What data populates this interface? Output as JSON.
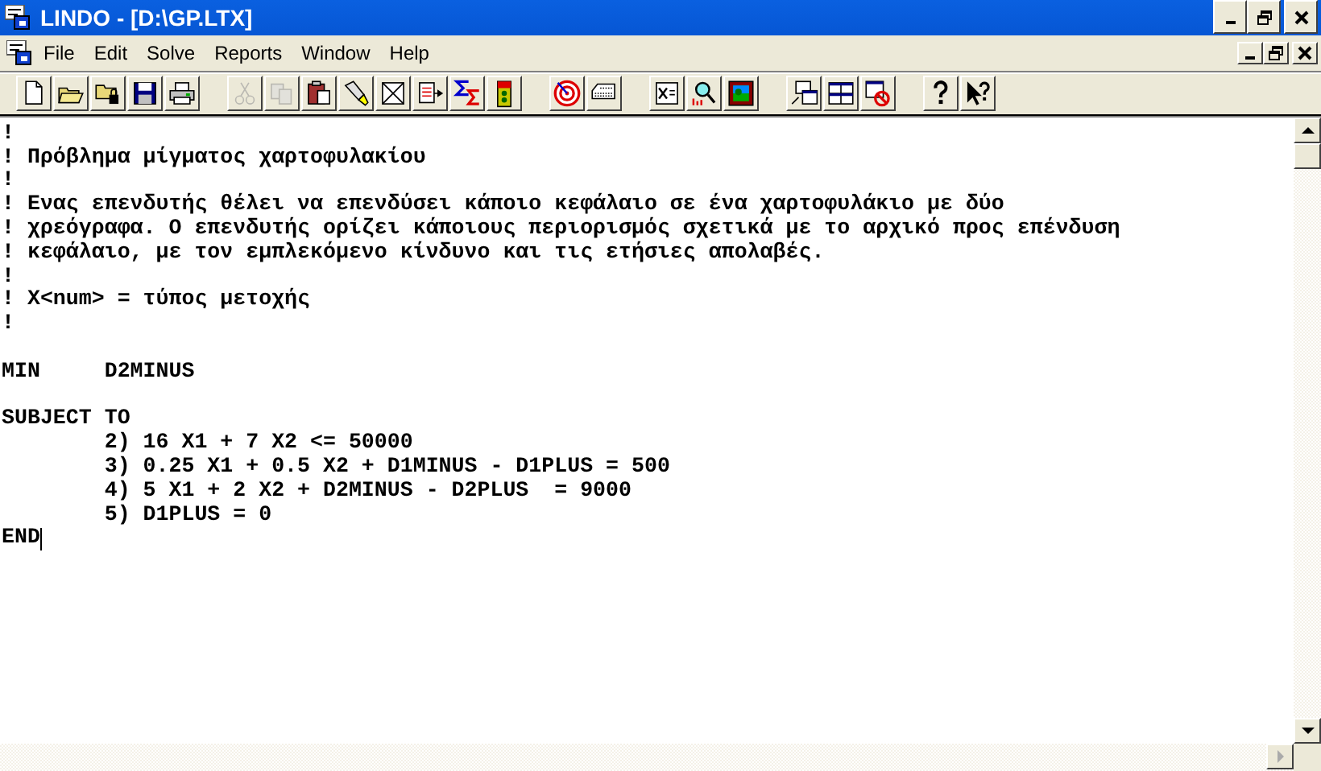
{
  "window": {
    "title": "LINDO - [D:\\GP.LTX]"
  },
  "menu": [
    {
      "label": "File"
    },
    {
      "label": "Edit"
    },
    {
      "label": "Solve"
    },
    {
      "label": "Reports"
    },
    {
      "label": "Window"
    },
    {
      "label": "Help"
    }
  ],
  "toolbar": {
    "groups": [
      {
        "buttons": [
          {
            "disabled": false
          },
          {
            "disabled": false
          },
          {
            "disabled": false
          },
          {
            "disabled": false
          },
          {
            "disabled": false
          }
        ]
      },
      {
        "buttons": [
          {
            "disabled": true
          },
          {
            "disabled": true
          },
          {
            "disabled": false
          },
          {
            "disabled": false
          },
          {
            "disabled": false
          },
          {
            "disabled": false
          },
          {
            "disabled": false
          },
          {
            "disabled": false
          }
        ]
      },
      {
        "buttons": [
          {
            "disabled": false
          },
          {
            "disabled": false
          }
        ]
      },
      {
        "buttons": [
          {
            "disabled": false
          },
          {
            "disabled": false
          },
          {
            "disabled": false
          }
        ]
      },
      {
        "buttons": [
          {
            "disabled": false
          },
          {
            "disabled": false
          },
          {
            "disabled": false
          }
        ]
      },
      {
        "buttons": [
          {
            "disabled": false
          },
          {
            "disabled": false
          }
        ]
      }
    ]
  },
  "editor": {
    "lines": [
      {
        "kind": "text",
        "text": "!"
      },
      {
        "kind": "text",
        "text": "! Πρόβλημα μίγματος χαρτοφυλακίου"
      },
      {
        "kind": "text",
        "text": "!"
      },
      {
        "kind": "text",
        "text": "! Ενας επενδυτής θέλει να επενδύσει κάποιο κεφάλαιο σε ένα χαρτοφυλάκιο με δύο"
      },
      {
        "kind": "text",
        "text": "! χρεόγραφα. Ο επενδυτής ορίζει κάποιους περιορισμός σχετικά με το αρχικό προς επένδυση"
      },
      {
        "kind": "text",
        "text": "! κεφάλαιο, με τον εμπλεκόμενο κίνδυνο και τις ετήσιες απολαβές."
      },
      {
        "kind": "text",
        "text": "!"
      },
      {
        "kind": "text",
        "text": "! X<num> = τύπος μετοχής"
      },
      {
        "kind": "text",
        "text": "!"
      },
      {
        "kind": "blank"
      },
      {
        "kind": "text",
        "text": "MIN     D2MINUS"
      },
      {
        "kind": "blank"
      },
      {
        "kind": "text",
        "text": "SUBJECT TO"
      },
      {
        "kind": "text",
        "text": "        2) 16 X1 + 7 X2 <= 50000"
      },
      {
        "kind": "text",
        "text": "        3) 0.25 X1 + 0.5 X2 + D1MINUS - D1PLUS = 500"
      },
      {
        "kind": "text",
        "text": "        4) 5 X1 + 2 X2 + D2MINUS - D2PLUS  = 9000"
      },
      {
        "kind": "text",
        "text": "        5) D1PLUS = 0"
      },
      {
        "kind": "cursor",
        "text": "END"
      }
    ]
  }
}
